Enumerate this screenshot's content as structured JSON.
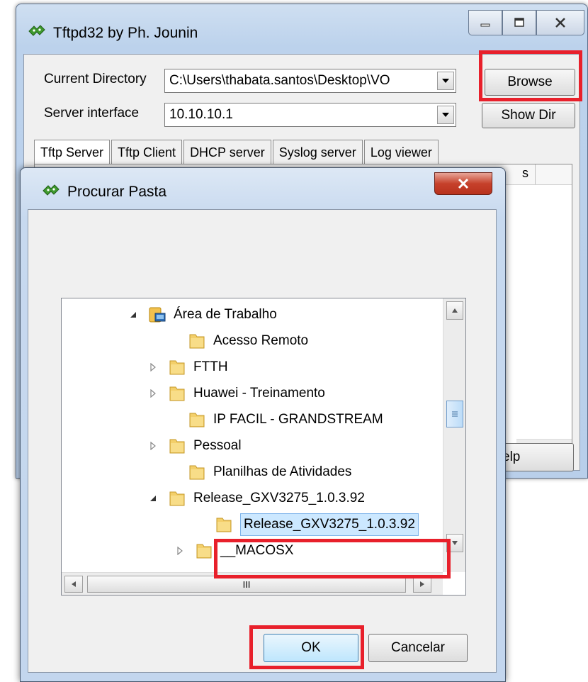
{
  "main_window": {
    "title": "Tftpd32 by Ph. Jounin",
    "current_directory_label": "Current Directory",
    "current_directory_value": "C:\\Users\\thabata.santos\\Desktop\\VO",
    "server_interface_label": "Server interface",
    "server_interface_value": "10.10.10.1",
    "browse_label": "Browse",
    "show_dir_label": "Show Dir",
    "tabs": [
      {
        "label": "Tftp Server"
      },
      {
        "label": "Tftp Client"
      },
      {
        "label": "DHCP server"
      },
      {
        "label": "Syslog server"
      },
      {
        "label": "Log viewer"
      }
    ],
    "partial_column_text": "s",
    "partial_help_label": "elp"
  },
  "dialog": {
    "title": "Procurar Pasta",
    "tree": [
      {
        "label": "Área de Trabalho",
        "expander": "expanded",
        "icon": "desktop-folder-icon"
      },
      {
        "label": "Acesso Remoto",
        "expander": "none",
        "icon": "folder-icon"
      },
      {
        "label": "FTTH",
        "expander": "collapsed",
        "icon": "folder-icon"
      },
      {
        "label": "Huawei - Treinamento",
        "expander": "collapsed",
        "icon": "folder-icon"
      },
      {
        "label": "IP FACIL - GRANDSTREAM",
        "expander": "none",
        "icon": "folder-icon"
      },
      {
        "label": "Pessoal",
        "expander": "collapsed",
        "icon": "folder-icon"
      },
      {
        "label": "Planilhas de Atividades",
        "expander": "none",
        "icon": "folder-icon"
      },
      {
        "label": "Release_GXV3275_1.0.3.92",
        "expander": "expanded",
        "icon": "folder-icon"
      },
      {
        "label": "Release_GXV3275_1.0.3.92",
        "expander": "none",
        "icon": "folder-icon",
        "selected": true
      },
      {
        "label": "__MACOSX",
        "expander": "collapsed",
        "icon": "folder-icon"
      }
    ],
    "hscroll_thumb_glyph": "III",
    "ok_label": "OK",
    "cancel_label": "Cancelar"
  },
  "colors": {
    "highlight_red": "#e8202b",
    "selection_blue": "#cce8ff",
    "close_red": "#c6412b"
  }
}
